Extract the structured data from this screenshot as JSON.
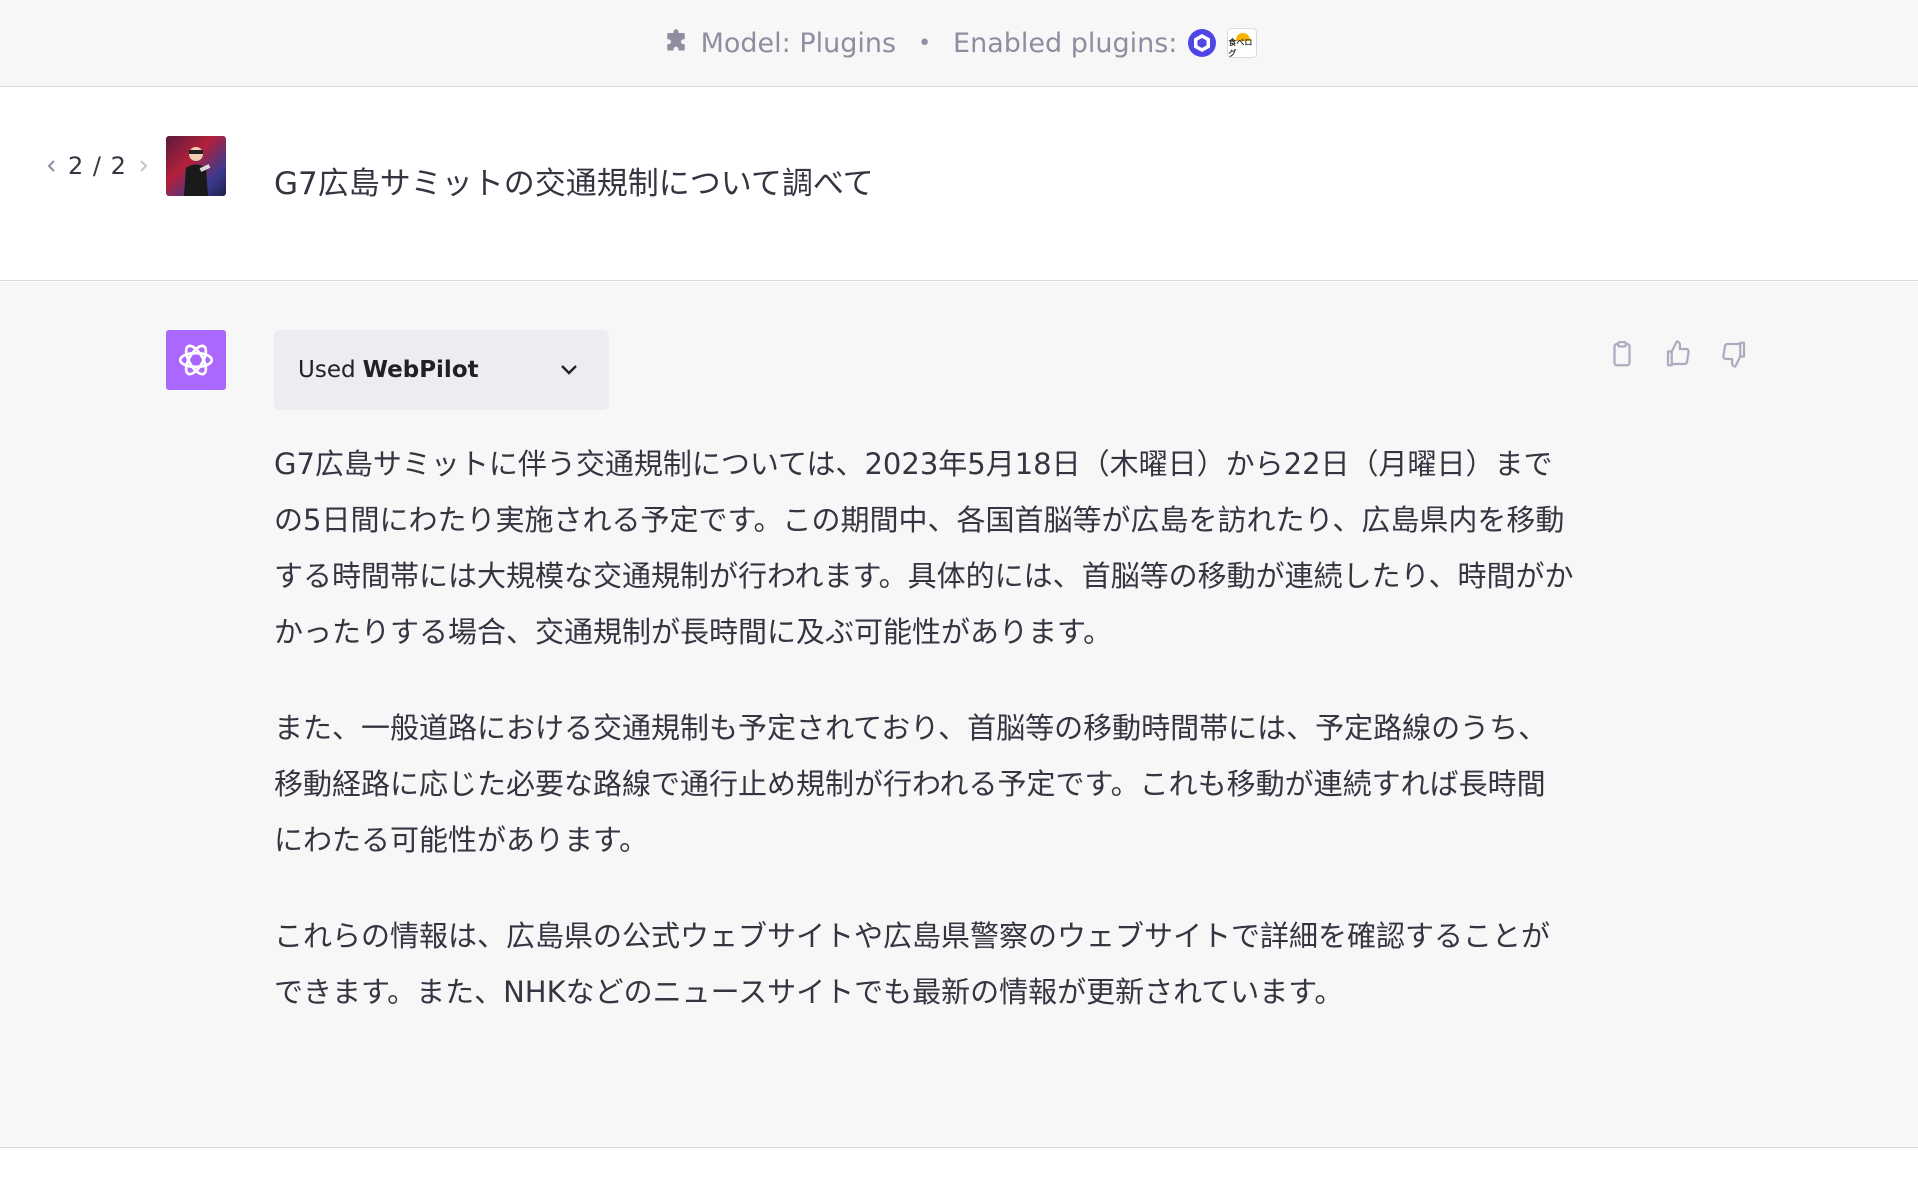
{
  "topbar": {
    "model_text": "Model: Plugins",
    "separator": "•",
    "enabled_text": "Enabled plugins:",
    "plugins": [
      {
        "icon": "webpilot-icon",
        "color": "#4f46e5"
      },
      {
        "icon": "tabelog-icon",
        "label": "食べログ"
      }
    ]
  },
  "user_message": {
    "pager": "2 / 2",
    "text": "G7広島サミットの交通規制について調べて"
  },
  "assistant_message": {
    "plugin_used_prefix": "Used",
    "plugin_used_name": "WebPilot",
    "avatar_color": "#ab68ff",
    "paragraphs": [
      "G7広島サミットに伴う交通規制については、2023年5月18日（木曜日）から22日（月曜日）までの5日間にわたり実施される予定です。この期間中、各国首脳等が広島を訪れたり、広島県内を移動する時間帯には大規模な交通規制が行われます。具体的には、首脳等の移動が連続したり、時間がかかったりする場合、交通規制が長時間に及ぶ可能性があります。",
      "また、一般道路における交通規制も予定されており、首脳等の移動時間帯には、予定路線のうち、移動経路に応じた必要な路線で通行止め規制が行われる予定です。これも移動が連続すれば長時間にわたる可能性があります。",
      "これらの情報は、広島県の公式ウェブサイトや広島県警察のウェブサイトで詳細を確認することができます。また、NHKなどのニュースサイトでも最新の情報が更新されています。"
    ]
  }
}
